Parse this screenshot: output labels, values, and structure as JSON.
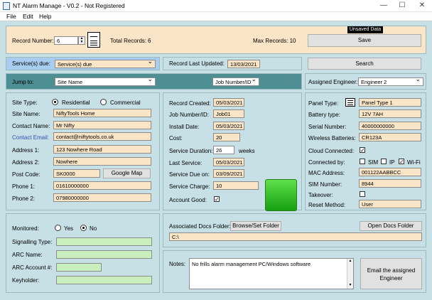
{
  "window": {
    "title": "NT Alarm Manage - V0.2 - Not Registered",
    "minimize": "—",
    "maximize": "☐",
    "close": "✕"
  },
  "menu": {
    "file": "File",
    "edit": "Edit",
    "help": "Help"
  },
  "record": {
    "label": "Record Number:",
    "value": "6",
    "total_label": "Total Records:",
    "total_value": "6",
    "max_label": "Max Records: 10",
    "unsaved": "Unsaved Data",
    "save": "Save"
  },
  "services": {
    "label": "Service(s) due:",
    "value": "Service(s) due",
    "last_updated_label": "Record Last Updated:",
    "last_updated": "13/03/2021",
    "search": "Search"
  },
  "jump": {
    "label": "Jump to:",
    "site_name": "Site Name",
    "job_number": "Job Number/ID",
    "assigned_label": "Assigned Engineer:",
    "assigned_value": "Engineer 2"
  },
  "site": {
    "type_label": "Site Type:",
    "residential": "Residential",
    "commercial": "Commercial",
    "site_name_label": "Site Name:",
    "site_name": "NiftyTools Home",
    "contact_name_label": "Contact Name:",
    "contact_name": "Mr Nifty",
    "contact_email_label": "Contact Email:",
    "contact_email": "contact@niftytools.co.uk",
    "address1_label": "Address 1:",
    "address1": "123 Nowhere Road",
    "address2_label": "Address 2:",
    "address2": "Nowhere",
    "postcode_label": "Post Code:",
    "postcode": "SK0000",
    "google_map": "Google Map",
    "phone1_label": "Phone 1:",
    "phone1": "01610000000",
    "phone2_label": "Phone 2:",
    "phone2": "07980000000"
  },
  "job": {
    "created_label": "Record Created:",
    "created": "05/03/2021",
    "jobnum_label": "Job Number/ID:",
    "jobnum": "Job01",
    "install_label": "Install Date:",
    "install": "05/03/2021",
    "cost_label": "Cost:",
    "cost": "20",
    "duration_label": "Service Duration:",
    "duration": "26",
    "weeks": "weeks",
    "last_service_label": "Last Service:",
    "last_service": "05/03/2021",
    "due_label": "Service Due on:",
    "due": "03/09/2021",
    "charge_label": "Service Charge:",
    "charge": "10",
    "account_good_label": "Account Good:",
    "account_good": "✓"
  },
  "panel": {
    "type_label": "Panel Type:",
    "type": "Panel Type 1",
    "battery_label": "Battery type:",
    "battery": "12V 7AH",
    "serial_label": "Serial Number:",
    "serial": "40000000000",
    "wireless_label": "Wireless Batteries:",
    "wireless": "CR123A",
    "cloud_label": "Cloud Connected:",
    "cloud": "✓",
    "connected_label": "Connected by:",
    "sim": "SIM",
    "ip": "IP",
    "wifi": "Wi-Fi",
    "wifi_check": "✓",
    "mac_label": "MAC Address:",
    "mac": "001122AABBCC",
    "simnum_label": "SIM Number:",
    "simnum": "8944",
    "takeover_label": "Takeover:",
    "reset_label": "Reset Method:",
    "reset": "User"
  },
  "monitor": {
    "label": "Monitored:",
    "yes": "Yes",
    "no": "No",
    "signalling_label": "Signalling Type:",
    "arc_name_label": "ARC Name:",
    "arc_account_label": "ARC Account #:",
    "keyholder_label": "Keyholder:"
  },
  "docs": {
    "label": "Associated Docs Folder:",
    "browse": "Browse/Set Folder",
    "open": "Open Docs Folder",
    "path": "C:\\"
  },
  "notes": {
    "label": "Notes:",
    "value": "No frills alarm management PC/Windows software",
    "email_btn": "Email the assigned Engineer"
  }
}
